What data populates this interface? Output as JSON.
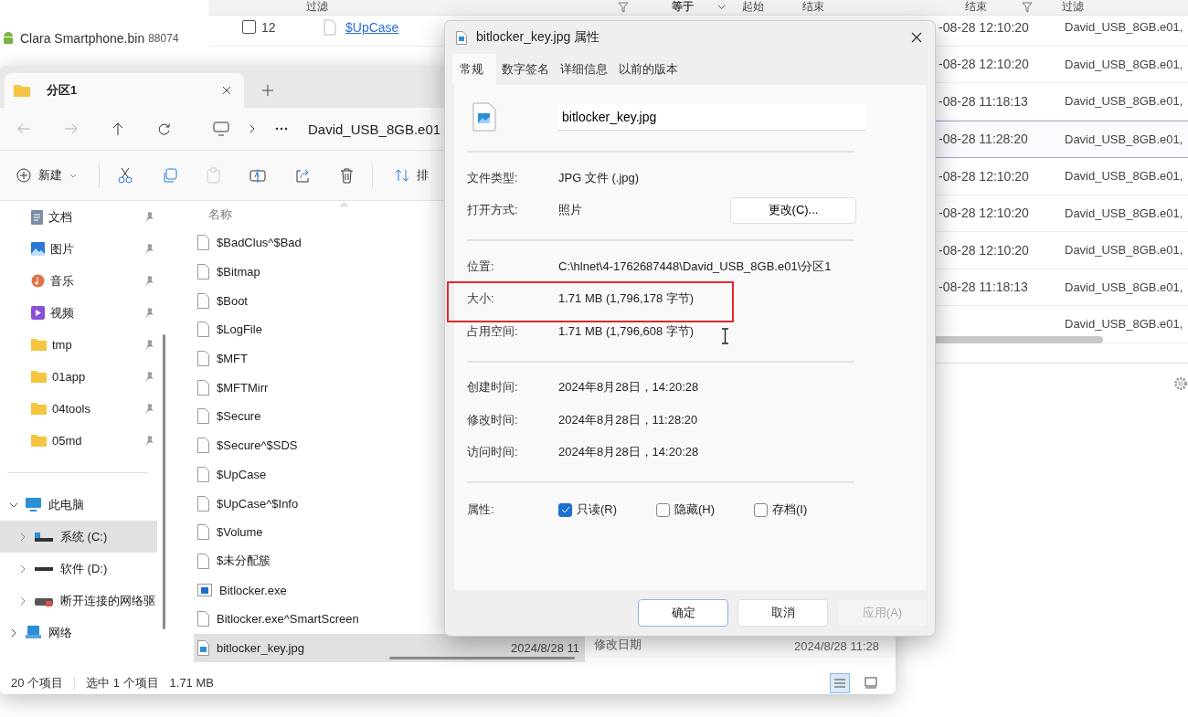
{
  "background_app": {
    "filters": [
      {
        "kind": "field",
        "label": "过滤"
      },
      {
        "kind": "dropdown",
        "label": "等于"
      },
      {
        "kind": "field",
        "label": "起始"
      },
      {
        "kind": "field",
        "label": "结束"
      },
      {
        "kind": "field",
        "label": "结束"
      },
      {
        "kind": "field",
        "label": "过滤"
      }
    ],
    "evidence_item": {
      "name": "Clara Smartphone.bin",
      "size": "88074"
    },
    "rows": [
      {
        "checked": false,
        "number": "12",
        "name": "$UpCase",
        "time": "-08-28 12:10:20",
        "source": "David_USB_8GB.e01,",
        "selected": false
      },
      {
        "time": "-08-28 12:10:20",
        "source": "David_USB_8GB.e01,",
        "selected": false
      },
      {
        "time": "-08-28 11:18:13",
        "source": "David_USB_8GB.e01,",
        "selected": false
      },
      {
        "time": "-08-28 11:28:20",
        "source": "David_USB_8GB.e01,",
        "selected": true
      },
      {
        "time": "-08-28 12:10:20",
        "source": "David_USB_8GB.e01,",
        "selected": false
      },
      {
        "time": "-08-28 12:10:20",
        "source": "David_USB_8GB.e01,",
        "selected": false
      },
      {
        "time": "-08-28 12:10:20",
        "source": "David_USB_8GB.e01,",
        "selected": false
      },
      {
        "time": "-08-28 11:18:13",
        "source": "David_USB_8GB.e01,",
        "selected": false
      },
      {
        "source": "David_USB_8GB.e01,",
        "selected": false
      }
    ]
  },
  "explorer": {
    "tab_title": "分区1",
    "path": "David_USB_8GB.e01",
    "new_label": "新建",
    "sort_label": "排",
    "quick_access": [
      {
        "label": "文档",
        "kind": "documents",
        "pinned": true
      },
      {
        "label": "图片",
        "kind": "pictures",
        "pinned": true
      },
      {
        "label": "音乐",
        "kind": "music",
        "pinned": true
      },
      {
        "label": "视频",
        "kind": "videos",
        "pinned": true
      },
      {
        "label": "tmp",
        "kind": "folder",
        "pinned": true
      },
      {
        "label": "01app",
        "kind": "folder",
        "pinned": true
      },
      {
        "label": "04tools",
        "kind": "folder",
        "pinned": true
      },
      {
        "label": "05md",
        "kind": "folder",
        "pinned": true
      }
    ],
    "tree": [
      {
        "label": "此电脑",
        "kind": "pc",
        "expanded": true,
        "selected": false,
        "children": [
          {
            "label": "系统 (C:)",
            "kind": "system-drive",
            "expanded": false,
            "selected": true
          },
          {
            "label": "软件 (D:)",
            "kind": "drive",
            "expanded": false,
            "selected": false
          },
          {
            "label": "断开连接的网络驱",
            "kind": "network-drive",
            "expanded": false,
            "selected": false
          }
        ]
      },
      {
        "label": "网络",
        "kind": "network",
        "expanded": false,
        "selected": false
      }
    ],
    "column_name": "名称",
    "files": [
      {
        "name": "$BadClus^$Bad",
        "kind": "file",
        "selected": false
      },
      {
        "name": "$Bitmap",
        "kind": "file",
        "selected": false
      },
      {
        "name": "$Boot",
        "kind": "file",
        "selected": false
      },
      {
        "name": "$LogFile",
        "kind": "file",
        "selected": false
      },
      {
        "name": "$MFT",
        "kind": "file",
        "selected": false
      },
      {
        "name": "$MFTMirr",
        "kind": "file",
        "selected": false
      },
      {
        "name": "$Secure",
        "kind": "file",
        "selected": false
      },
      {
        "name": "$Secure^$SDS",
        "kind": "file",
        "selected": false
      },
      {
        "name": "$UpCase",
        "kind": "file",
        "selected": false
      },
      {
        "name": "$UpCase^$Info",
        "kind": "file",
        "selected": false
      },
      {
        "name": "$Volume",
        "kind": "file",
        "selected": false
      },
      {
        "name": "$未分配簇",
        "kind": "file",
        "selected": false
      },
      {
        "name": "Bitlocker.exe",
        "kind": "exe",
        "selected": false
      },
      {
        "name": "Bitlocker.exe^SmartScreen",
        "kind": "file",
        "selected": false
      },
      {
        "name": "bitlocker_key.jpg",
        "kind": "image",
        "selected": true,
        "date": "2024/8/28 11"
      }
    ],
    "details": {
      "label": "修改日期",
      "value": "2024/8/28 11:28"
    },
    "status": {
      "count": "20 个项目",
      "selection": "选中 1 个项目",
      "size": "1.71 MB"
    },
    "view_buttons": [
      {
        "kind": "details",
        "selected": true
      },
      {
        "kind": "tiles",
        "selected": false
      }
    ]
  },
  "dialog": {
    "title": "bitlocker_key.jpg 属性",
    "tabs": [
      {
        "label": "常规",
        "selected": true
      },
      {
        "label": "数字签名",
        "selected": false
      },
      {
        "label": "详细信息",
        "selected": false
      },
      {
        "label": "以前的版本",
        "selected": false
      }
    ],
    "file_name": "bitlocker_key.jpg",
    "groups": [
      [
        {
          "label": "文件类型:",
          "value": "JPG 文件 (.jpg)",
          "highlighted": false
        },
        {
          "label": "打开方式:",
          "value": "照片",
          "button": "更改(C)...",
          "highlighted": false
        }
      ],
      [
        {
          "label": "位置:",
          "value": "C:\\hlnet\\4-1762687448\\David_USB_8GB.e01\\分区1",
          "highlighted": false
        },
        {
          "label": "大小:",
          "value": "1.71 MB (1,796,178 字节)",
          "highlighted": true
        },
        {
          "label": "占用空间:",
          "value": "1.71 MB (1,796,608 字节)",
          "highlighted": false
        }
      ],
      [
        {
          "label": "创建时间:",
          "value": "2024年8月28日，14:20:28",
          "highlighted": false
        },
        {
          "label": "修改时间:",
          "value": "2024年8月28日，11:28:20",
          "highlighted": false
        },
        {
          "label": "访问时间:",
          "value": "2024年8月28日，14:20:28",
          "highlighted": false
        }
      ]
    ],
    "attributes_label": "属性:",
    "attributes": [
      {
        "label": "只读(R)",
        "checked": true
      },
      {
        "label": "隐藏(H)",
        "checked": false
      },
      {
        "label": "存档(I)",
        "checked": false
      }
    ],
    "buttons": [
      {
        "label": "确定",
        "kind": "default",
        "disabled": false
      },
      {
        "label": "取消",
        "kind": "normal",
        "disabled": false
      },
      {
        "label": "应用(A)",
        "kind": "normal",
        "disabled": true
      }
    ]
  }
}
